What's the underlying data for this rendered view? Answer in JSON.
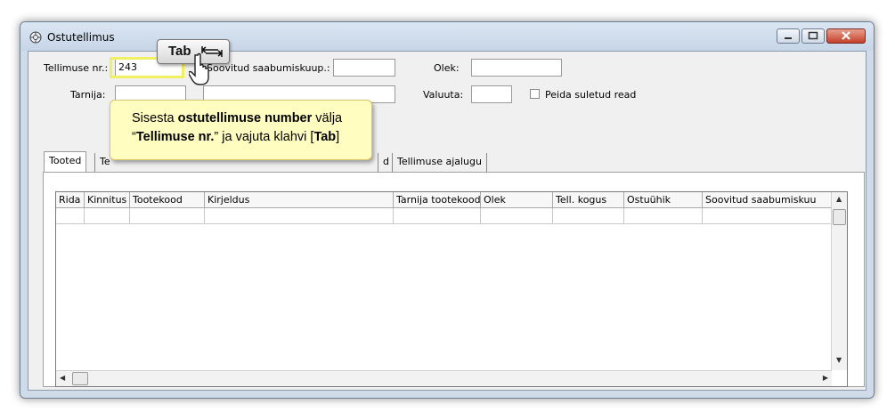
{
  "window": {
    "title": "Ostutellimus"
  },
  "form": {
    "order_no_label": "Tellimuse nr.:",
    "order_no_value": "243",
    "supplier_label": "Tarnija:",
    "supplier_value": "",
    "desired_date_label": "Soovitud saabumiskuup.:",
    "desired_date_value": "",
    "status_label": "Olek:",
    "status_value": "",
    "currency_label": "Valuuta:",
    "currency_value": "",
    "hide_closed_label": "Peida suletud read"
  },
  "tabs": [
    {
      "label": "Tooted"
    },
    {
      "label": "Te"
    },
    {
      "label": "d"
    },
    {
      "label": "Tellimuse ajalugu"
    }
  ],
  "grid": {
    "columns": [
      "Rida",
      "Kinnitus",
      "Tootekood",
      "Kirjeldus",
      "Tarnija tootekood",
      "Olek",
      "Tell. kogus",
      "Ostuühik",
      "Soovitud saabumiskuu"
    ]
  },
  "overlay": {
    "key_label": "Tab",
    "callout_line1_a": "Sisesta ",
    "callout_line1_b": "ostutellimuse number",
    "callout_line1_c": " välja",
    "callout_line2_a": "“",
    "callout_line2_b": "Tellimuse nr.",
    "callout_line2_c": "” ja vajuta klahvi [",
    "callout_line2_d": "Tab",
    "callout_line2_e": "]"
  }
}
